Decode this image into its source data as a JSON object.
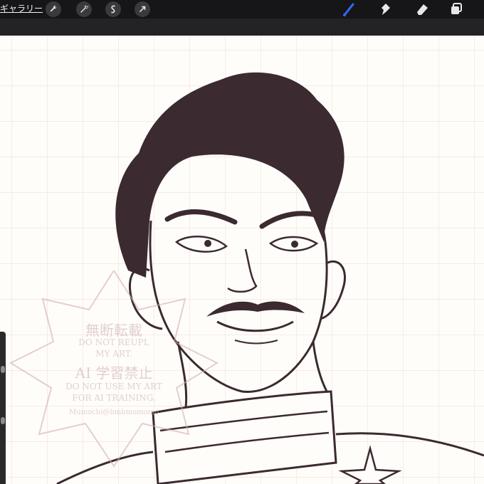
{
  "toolbar": {
    "gallery_label": "ギャラリー",
    "left_tools": [
      {
        "name": "wrench-icon"
      },
      {
        "name": "adjustments-icon"
      },
      {
        "name": "selection-icon"
      },
      {
        "name": "transform-arrow-icon"
      }
    ],
    "right_tools": [
      {
        "name": "brush-icon",
        "active": true
      },
      {
        "name": "smudge-icon"
      },
      {
        "name": "eraser-icon"
      },
      {
        "name": "layers-icon"
      }
    ],
    "active_color": "#2f6bff"
  },
  "watermark": {
    "line1": "無断転載",
    "line2": "DO NOT REUPL",
    "line3": "MY ART.",
    "line4": "AI 学習禁止",
    "line5": "DO NOT USE MY ART",
    "line6": "FOR AI TRAINING.",
    "line7": "Mumochi@bmbmomomo"
  },
  "colors": {
    "ink": "#3b2a30",
    "grid": "#f3e4dc",
    "canvas": "#fffdfa"
  }
}
